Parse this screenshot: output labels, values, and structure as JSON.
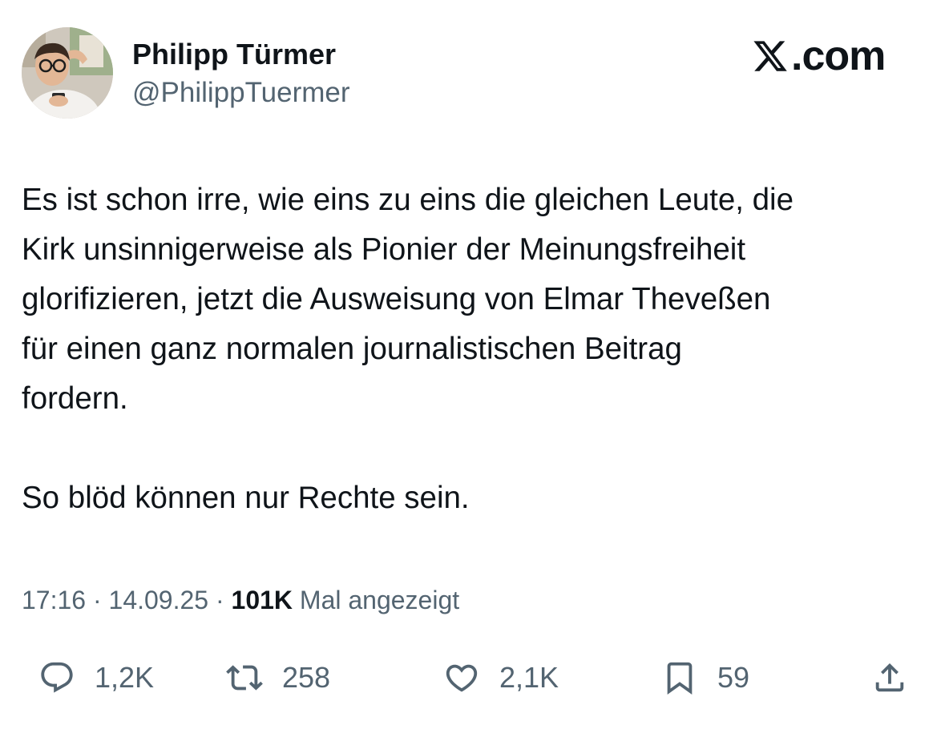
{
  "author": {
    "display_name": "Philipp Türmer",
    "handle": "@PhilippTuermer",
    "avatar_icon": "profile-photo"
  },
  "brand": {
    "text": ".com",
    "logo_icon": "x-logo-icon"
  },
  "tweet": {
    "paragraph_1": "Es ist schon irre, wie eins zu eins die gleichen Leute, die\nKirk unsinnigerweise als Pionier der Meinungsfreiheit\nglorifizieren, jetzt die Ausweisung von Elmar Theveßen\nfür einen ganz normalen journalistischen Beitrag\nfordern.",
    "paragraph_2": "So blöd können nur Rechte sein."
  },
  "meta": {
    "time": "17:16",
    "separator": " · ",
    "date": "14.09.25",
    "views": "101K",
    "views_label": " Mal angezeigt"
  },
  "actions": {
    "replies": "1,2K",
    "reposts": "258",
    "likes": "2,1K",
    "bookmarks": "59"
  },
  "colors": {
    "text": "#0f1419",
    "secondary": "#536471",
    "background": "#ffffff"
  }
}
